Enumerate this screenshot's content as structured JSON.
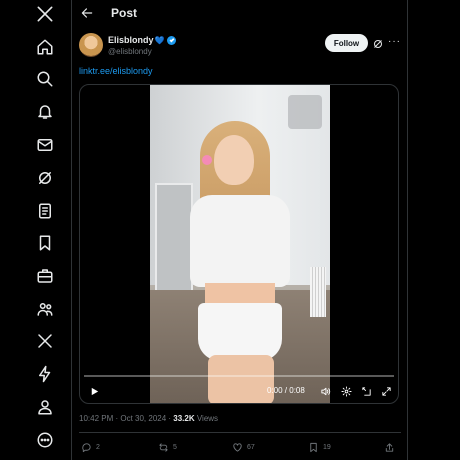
{
  "header": {
    "title": "Post"
  },
  "tweet": {
    "author_name": "Elisblondy",
    "author_handle": "@elisblondy",
    "follow_label": "Follow",
    "link_text": "linktr.ee/elisblondy",
    "timestamp": "10:42 PM · Oct 30, 2024 · ",
    "views_count": "33.2K",
    "views_label": " Views"
  },
  "video": {
    "time": "0:00 / 0:08",
    "progress": 0.0
  },
  "actions": {
    "replies": "2",
    "reposts": "5",
    "likes": "67",
    "bookmarks": "19"
  },
  "colors": {
    "accent": "#1d9bf0",
    "background": "#000000",
    "muted": "#71767b"
  },
  "icons": [
    "x-logo-icon",
    "home-icon",
    "search-icon",
    "bell-icon",
    "mail-icon",
    "grok-icon",
    "list-icon",
    "bookmark-icon",
    "briefcase-icon",
    "communities-icon",
    "x-premium-icon",
    "lightning-icon",
    "profile-icon",
    "more-circle-icon"
  ]
}
